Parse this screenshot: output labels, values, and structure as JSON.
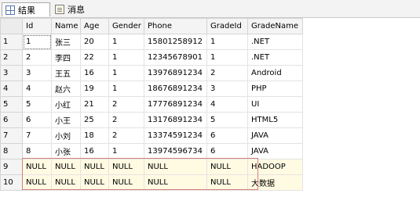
{
  "tabs": [
    {
      "label": "结果",
      "icon": "grid-icon"
    },
    {
      "label": "消息",
      "icon": "message-icon"
    }
  ],
  "columns": [
    "Id",
    "Name",
    "Age",
    "Gender",
    "Phone",
    "GradeId",
    "GradeName"
  ],
  "rows": [
    {
      "rownum": "1",
      "cells": [
        "1",
        "张三",
        "20",
        "1",
        "15801258912",
        "1",
        ".NET"
      ]
    },
    {
      "rownum": "2",
      "cells": [
        "2",
        "李四",
        "22",
        "1",
        "12345678901",
        "1",
        ".NET"
      ]
    },
    {
      "rownum": "3",
      "cells": [
        "3",
        "王五",
        "16",
        "1",
        "13976891234",
        "2",
        "Android"
      ]
    },
    {
      "rownum": "4",
      "cells": [
        "4",
        "赵六",
        "19",
        "1",
        "18676891234",
        "3",
        "PHP"
      ]
    },
    {
      "rownum": "5",
      "cells": [
        "5",
        "小红",
        "21",
        "2",
        "17776891234",
        "4",
        "UI"
      ]
    },
    {
      "rownum": "6",
      "cells": [
        "6",
        "小王",
        "25",
        "2",
        "13176891234",
        "5",
        "HTML5"
      ]
    },
    {
      "rownum": "7",
      "cells": [
        "7",
        "小刘",
        "18",
        "2",
        "13374591234",
        "6",
        "JAVA"
      ]
    },
    {
      "rownum": "8",
      "cells": [
        "8",
        "小张",
        "16",
        "1",
        "13974596734",
        "6",
        "JAVA"
      ]
    },
    {
      "rownum": "9",
      "cells": [
        "NULL",
        "NULL",
        "NULL",
        "NULL",
        "NULL",
        "NULL",
        "HADOOP"
      ]
    },
    {
      "rownum": "10",
      "cells": [
        "NULL",
        "NULL",
        "NULL",
        "NULL",
        "NULL",
        "NULL",
        "大数据"
      ]
    }
  ]
}
